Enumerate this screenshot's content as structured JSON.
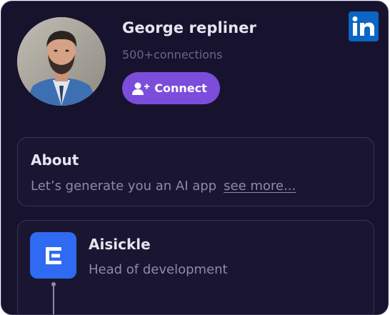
{
  "profile": {
    "name": "George repliner",
    "connections": "500+connections",
    "connect_label": "Connect"
  },
  "icons": {
    "linkedin": "linkedin-icon",
    "connect": "add-user-icon",
    "company": "aisickle-logo-icon"
  },
  "about": {
    "title": "About",
    "text": "Let’s generate you an AI app",
    "see_more": "see more..."
  },
  "experience": {
    "company": "Aisickle",
    "role": "Head of development"
  },
  "colors": {
    "background": "#17132e",
    "accent": "#7c4ddb",
    "linkedin": "#0a66c2",
    "company_logo": "#2f6bf2"
  }
}
